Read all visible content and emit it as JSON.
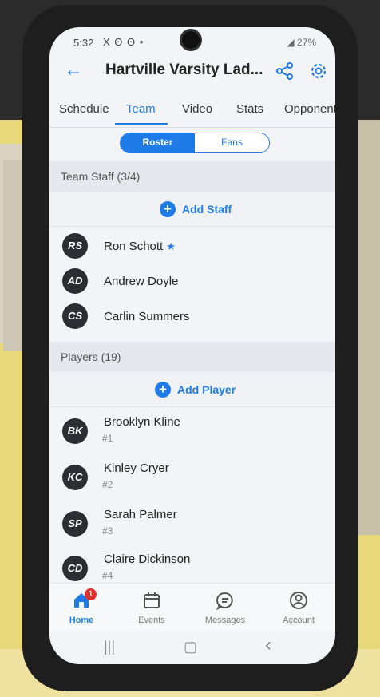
{
  "status": {
    "time": "5:32",
    "left_icons": "X ʘ ʘ •",
    "battery": "27%"
  },
  "header": {
    "title": "Hartville Varsity Lad...",
    "back_icon": "arrow-left-icon",
    "share_icon": "share-icon",
    "settings_icon": "gear-icon"
  },
  "tabs": [
    "Schedule",
    "Team",
    "Video",
    "Stats",
    "Opponents"
  ],
  "active_tab": "Team",
  "segment": {
    "roster": "Roster",
    "fans": "Fans",
    "selected": "Roster"
  },
  "staff": {
    "title": "Team Staff (3/4)",
    "add_label": "Add Staff",
    "members": [
      {
        "initials": "RS",
        "name": "Ron Schott",
        "starred": true
      },
      {
        "initials": "AD",
        "name": "Andrew Doyle"
      },
      {
        "initials": "CS",
        "name": "Carlin Summers"
      }
    ]
  },
  "players": {
    "title": "Players (19)",
    "add_label": "Add Player",
    "members": [
      {
        "initials": "BK",
        "name": "Brooklyn Kline",
        "number": "#1"
      },
      {
        "initials": "KC",
        "name": "Kinley Cryer",
        "number": "#2"
      },
      {
        "initials": "SP",
        "name": "Sarah Palmer",
        "number": "#3"
      },
      {
        "initials": "CD",
        "name": "Claire Dickinson",
        "number": "#4"
      }
    ]
  },
  "bottom_nav": {
    "items": [
      {
        "label": "Home",
        "icon": "home-icon",
        "badge": "1"
      },
      {
        "label": "Events",
        "icon": "calendar-icon"
      },
      {
        "label": "Messages",
        "icon": "chat-icon"
      },
      {
        "label": "Account",
        "icon": "account-icon"
      }
    ],
    "active": "Home"
  },
  "system_nav": {
    "recents": "|||",
    "home": "▢",
    "back": "‹"
  },
  "colors": {
    "accent": "#1f7be8",
    "avatar": "#2c2e33",
    "badge": "#e0312f"
  }
}
